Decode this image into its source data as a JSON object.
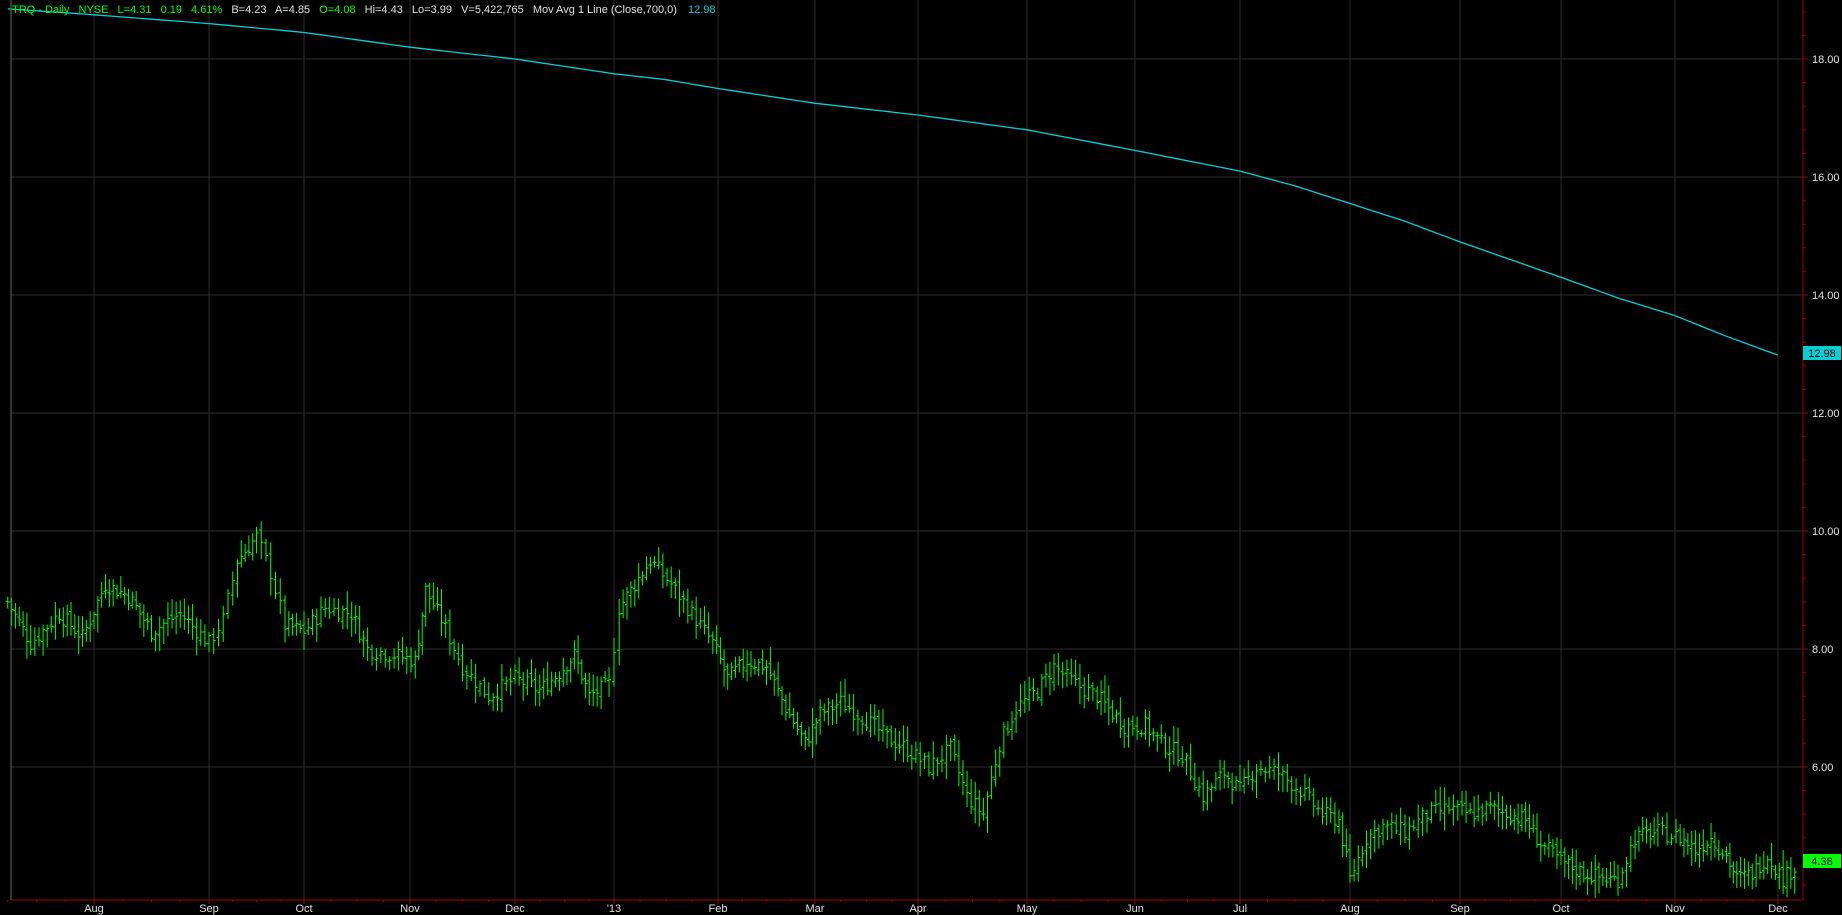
{
  "header": {
    "symbol": "TRQ - Daily",
    "exchange": "NYSE",
    "last": "L=4.31",
    "change": "0.19",
    "change_pct": "4.61%",
    "bid": "B=4.23",
    "ask": "A=4.85",
    "open": "O=4.08",
    "high": "Hi=4.43",
    "low": "Lo=3.99",
    "volume": "V=5,422,765",
    "study_label": "Mov Avg 1 Line (Close,700,0)",
    "study_value": "12.98"
  },
  "chart_data": {
    "type": "line",
    "series_style": "ohlc-bars-with-moving-average",
    "price_scale": "right",
    "ylim": [
      3.9,
      19.0
    ],
    "grid": true,
    "yticks": [
      "18.00",
      "16.00",
      "14.00",
      "12.00",
      "10.00",
      "8.00",
      "6.00"
    ],
    "xticks": [
      {
        "label": "Aug",
        "month": 1
      },
      {
        "label": "Sep",
        "month": 2
      },
      {
        "label": "Oct",
        "month": 3
      },
      {
        "label": "Nov",
        "month": 4
      },
      {
        "label": "Dec",
        "month": 5
      },
      {
        "label": "'13",
        "month": 6
      },
      {
        "label": "Feb",
        "month": 7
      },
      {
        "label": "Mar",
        "month": 8
      },
      {
        "label": "Apr",
        "month": 9
      },
      {
        "label": "May",
        "month": 10
      },
      {
        "label": "Jun",
        "month": 11
      },
      {
        "label": "Jul",
        "month": 12
      },
      {
        "label": "Aug",
        "month": 13
      },
      {
        "label": "Sep",
        "month": 14
      },
      {
        "label": "Oct",
        "month": 15
      },
      {
        "label": "Nov",
        "month": 16
      },
      {
        "label": "Dec",
        "month": 17
      }
    ],
    "x_range_months": [
      0.25,
      17.2
    ],
    "moving_average": {
      "color": "#00d0d8",
      "points": [
        [
          0.25,
          18.85
        ],
        [
          1.0,
          18.75
        ],
        [
          2.0,
          18.6
        ],
        [
          3.0,
          18.45
        ],
        [
          4.0,
          18.2
        ],
        [
          5.0,
          18.0
        ],
        [
          6.0,
          17.75
        ],
        [
          6.5,
          17.65
        ],
        [
          7.0,
          17.5
        ],
        [
          8.0,
          17.25
        ],
        [
          9.0,
          17.05
        ],
        [
          10.0,
          16.8
        ],
        [
          11.0,
          16.45
        ],
        [
          12.0,
          16.1
        ],
        [
          12.5,
          15.85
        ],
        [
          13.0,
          15.55
        ],
        [
          13.5,
          15.25
        ],
        [
          14.0,
          14.9
        ],
        [
          14.5,
          14.6
        ],
        [
          15.0,
          14.3
        ],
        [
          15.5,
          13.95
        ],
        [
          16.0,
          13.65
        ],
        [
          16.5,
          13.3
        ],
        [
          17.0,
          12.98
        ]
      ],
      "last_value": "12.98"
    },
    "price": {
      "color": "#00ff00",
      "closes": [
        [
          0.25,
          8.8
        ],
        [
          0.45,
          8.1
        ],
        [
          0.7,
          8.6
        ],
        [
          0.9,
          8.2
        ],
        [
          1.1,
          9.1
        ],
        [
          1.3,
          8.9
        ],
        [
          1.5,
          8.3
        ],
        [
          1.75,
          8.6
        ],
        [
          2.0,
          8.1
        ],
        [
          2.15,
          8.5
        ],
        [
          2.3,
          9.5
        ],
        [
          2.5,
          9.9
        ],
        [
          2.65,
          9.3
        ],
        [
          2.8,
          8.4
        ],
        [
          3.0,
          8.3
        ],
        [
          3.2,
          8.7
        ],
        [
          3.45,
          8.6
        ],
        [
          3.6,
          8.0
        ],
        [
          3.85,
          7.9
        ],
        [
          4.05,
          7.8
        ],
        [
          4.15,
          9.0
        ],
        [
          4.3,
          8.5
        ],
        [
          4.5,
          7.7
        ],
        [
          4.75,
          7.2
        ],
        [
          5.0,
          7.5
        ],
        [
          5.25,
          7.3
        ],
        [
          5.45,
          7.6
        ],
        [
          5.6,
          7.9
        ],
        [
          5.75,
          7.2
        ],
        [
          5.95,
          7.4
        ],
        [
          6.05,
          8.7
        ],
        [
          6.2,
          9.1
        ],
        [
          6.35,
          9.5
        ],
        [
          6.55,
          9.1
        ],
        [
          6.75,
          8.6
        ],
        [
          6.95,
          8.1
        ],
        [
          7.1,
          7.5
        ],
        [
          7.3,
          7.8
        ],
        [
          7.5,
          7.7
        ],
        [
          7.7,
          7.0
        ],
        [
          7.9,
          6.4
        ],
        [
          8.05,
          6.9
        ],
        [
          8.25,
          7.1
        ],
        [
          8.5,
          6.8
        ],
        [
          8.7,
          6.5
        ],
        [
          8.9,
          6.3
        ],
        [
          9.1,
          6.0
        ],
        [
          9.3,
          6.3
        ],
        [
          9.45,
          5.5
        ],
        [
          9.6,
          5.2
        ],
        [
          9.75,
          6.4
        ],
        [
          9.9,
          7.0
        ],
        [
          10.1,
          7.3
        ],
        [
          10.25,
          7.7
        ],
        [
          10.45,
          7.4
        ],
        [
          10.65,
          7.2
        ],
        [
          10.9,
          6.7
        ],
        [
          11.1,
          6.7
        ],
        [
          11.25,
          6.4
        ],
        [
          11.45,
          6.2
        ],
        [
          11.65,
          5.5
        ],
        [
          11.85,
          5.9
        ],
        [
          12.0,
          5.6
        ],
        [
          12.15,
          6.0
        ],
        [
          12.35,
          5.9
        ],
        [
          12.55,
          5.6
        ],
        [
          12.75,
          5.2
        ],
        [
          12.9,
          5.1
        ],
        [
          13.0,
          4.1
        ],
        [
          13.15,
          4.8
        ],
        [
          13.3,
          5.0
        ],
        [
          13.5,
          4.9
        ],
        [
          13.7,
          5.2
        ],
        [
          13.9,
          5.3
        ],
        [
          14.1,
          5.2
        ],
        [
          14.3,
          5.3
        ],
        [
          14.5,
          5.2
        ],
        [
          14.65,
          5.1
        ],
        [
          14.8,
          4.7
        ],
        [
          15.0,
          4.4
        ],
        [
          15.2,
          4.2
        ],
        [
          15.4,
          4.1
        ],
        [
          15.5,
          4.1
        ],
        [
          15.65,
          4.8
        ],
        [
          15.85,
          4.9
        ],
        [
          16.05,
          4.8
        ],
        [
          16.2,
          4.6
        ],
        [
          16.35,
          4.8
        ],
        [
          16.5,
          4.5
        ],
        [
          16.6,
          4.1
        ],
        [
          16.75,
          4.2
        ],
        [
          16.9,
          4.5
        ],
        [
          17.05,
          4.1
        ],
        [
          17.2,
          4.38
        ]
      ],
      "last_value": "4.38"
    }
  }
}
